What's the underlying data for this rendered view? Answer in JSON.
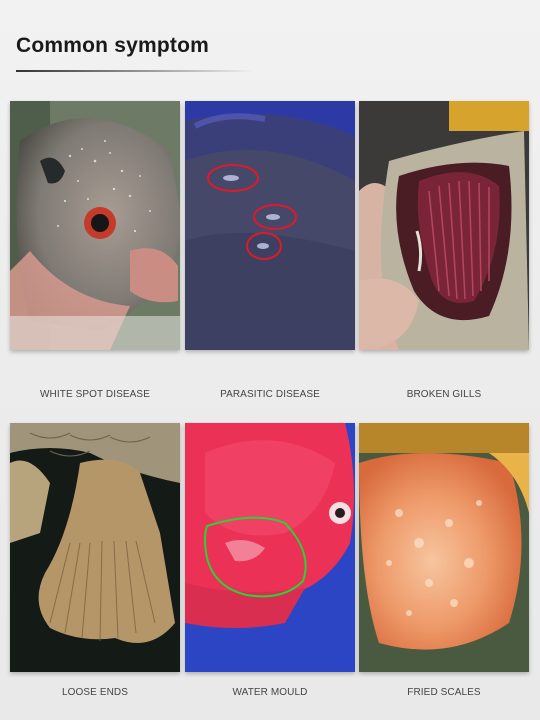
{
  "heading": "Common symptom",
  "symptoms": [
    {
      "label": "WHITE SPOT DISEASE"
    },
    {
      "label": "PARASITIC DISEASE"
    },
    {
      "label": "BROKEN GILLS"
    },
    {
      "label": "LOOSE ENDS"
    },
    {
      "label": "WATER MOULD"
    },
    {
      "label": "FRIED SCALES"
    }
  ],
  "colors": {
    "marker_red": "#e0192a",
    "marker_green": "#2bd13a"
  }
}
